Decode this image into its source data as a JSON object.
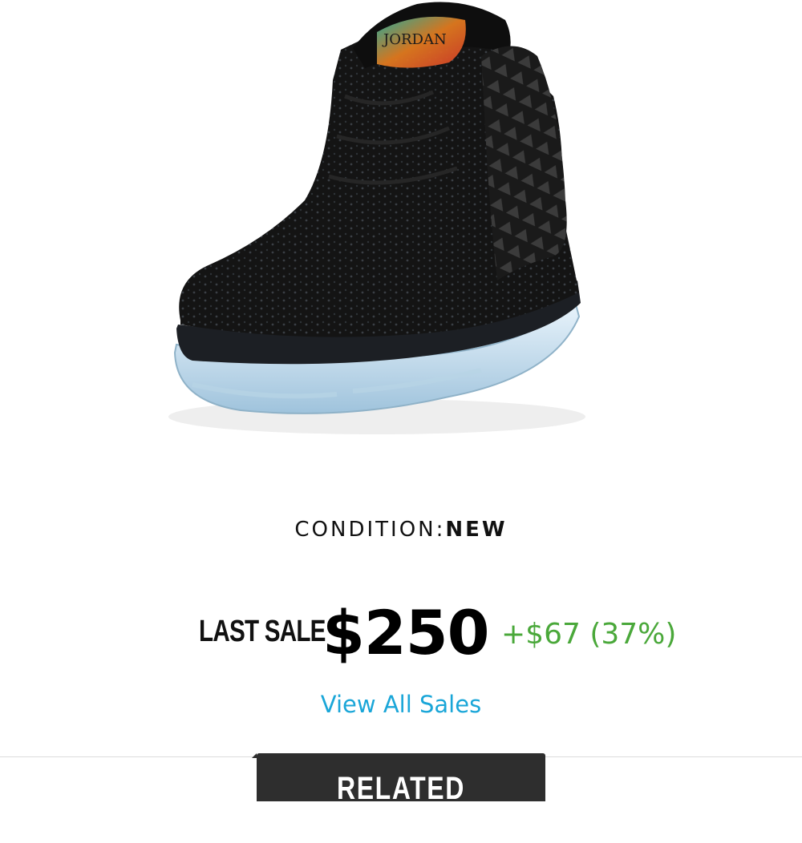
{
  "product": {
    "image_icon": "sneaker-photo",
    "logo_text": "JORDAN"
  },
  "condition": {
    "label": "CONDITION:",
    "value": "NEW"
  },
  "last_sale": {
    "label": "LAST SALE",
    "price": "$250",
    "change": "+$67 (37%)",
    "change_color": "#4aa83a"
  },
  "links": {
    "view_all_sales": "View All Sales",
    "link_color": "#1aa6d8"
  },
  "tabs": {
    "related_products": "RELATED PRODUCTS"
  }
}
